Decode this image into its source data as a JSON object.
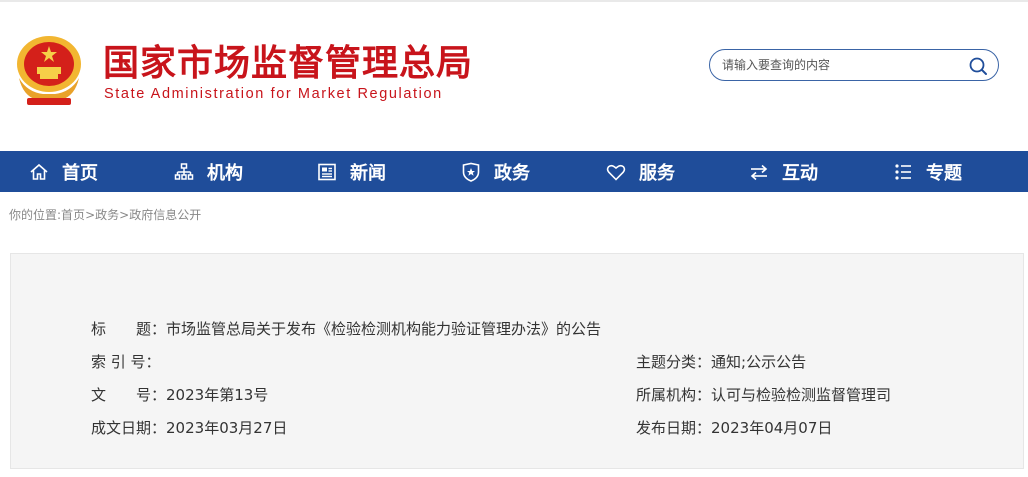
{
  "header": {
    "title_cn": "国家市场监督管理总局",
    "title_en": "State Administration for Market Regulation",
    "emblem_icon": "national-emblem-icon"
  },
  "search": {
    "placeholder": "请输入要查询的内容",
    "icon": "search-icon"
  },
  "nav": {
    "items": [
      {
        "label": "首页",
        "icon": "home-icon"
      },
      {
        "label": "机构",
        "icon": "org-chart-icon"
      },
      {
        "label": "新闻",
        "icon": "newspaper-icon"
      },
      {
        "label": "政务",
        "icon": "shield-icon"
      },
      {
        "label": "服务",
        "icon": "heart-icon"
      },
      {
        "label": "互动",
        "icon": "exchange-arrows-icon"
      },
      {
        "label": "专题",
        "icon": "topic-list-icon"
      }
    ]
  },
  "breadcrumb": {
    "prefix": "你的位置:",
    "items": [
      "首页",
      "政务",
      "政府信息公开"
    ],
    "separator": ">"
  },
  "doc_info": {
    "title_label": "标　　题：",
    "title_value": "市场监管总局关于发布《检验检测机构能力验证管理办法》的公告",
    "index_label": "索 引 号：",
    "index_value": "",
    "topic_label": "主题分类：",
    "topic_value": "通知;公示公告",
    "docno_label": "文　　号：",
    "docno_value": "2023年第13号",
    "org_label": "所属机构：",
    "org_value": "认可与检验检测监督管理司",
    "written_label": "成文日期：",
    "written_value": "2023年03月27日",
    "publish_label": "发布日期：",
    "publish_value": "2023年04月07日"
  },
  "colors": {
    "brand_red": "#c8141b",
    "nav_blue": "#1f4d9a",
    "panel_bg": "#f5f5f5"
  }
}
